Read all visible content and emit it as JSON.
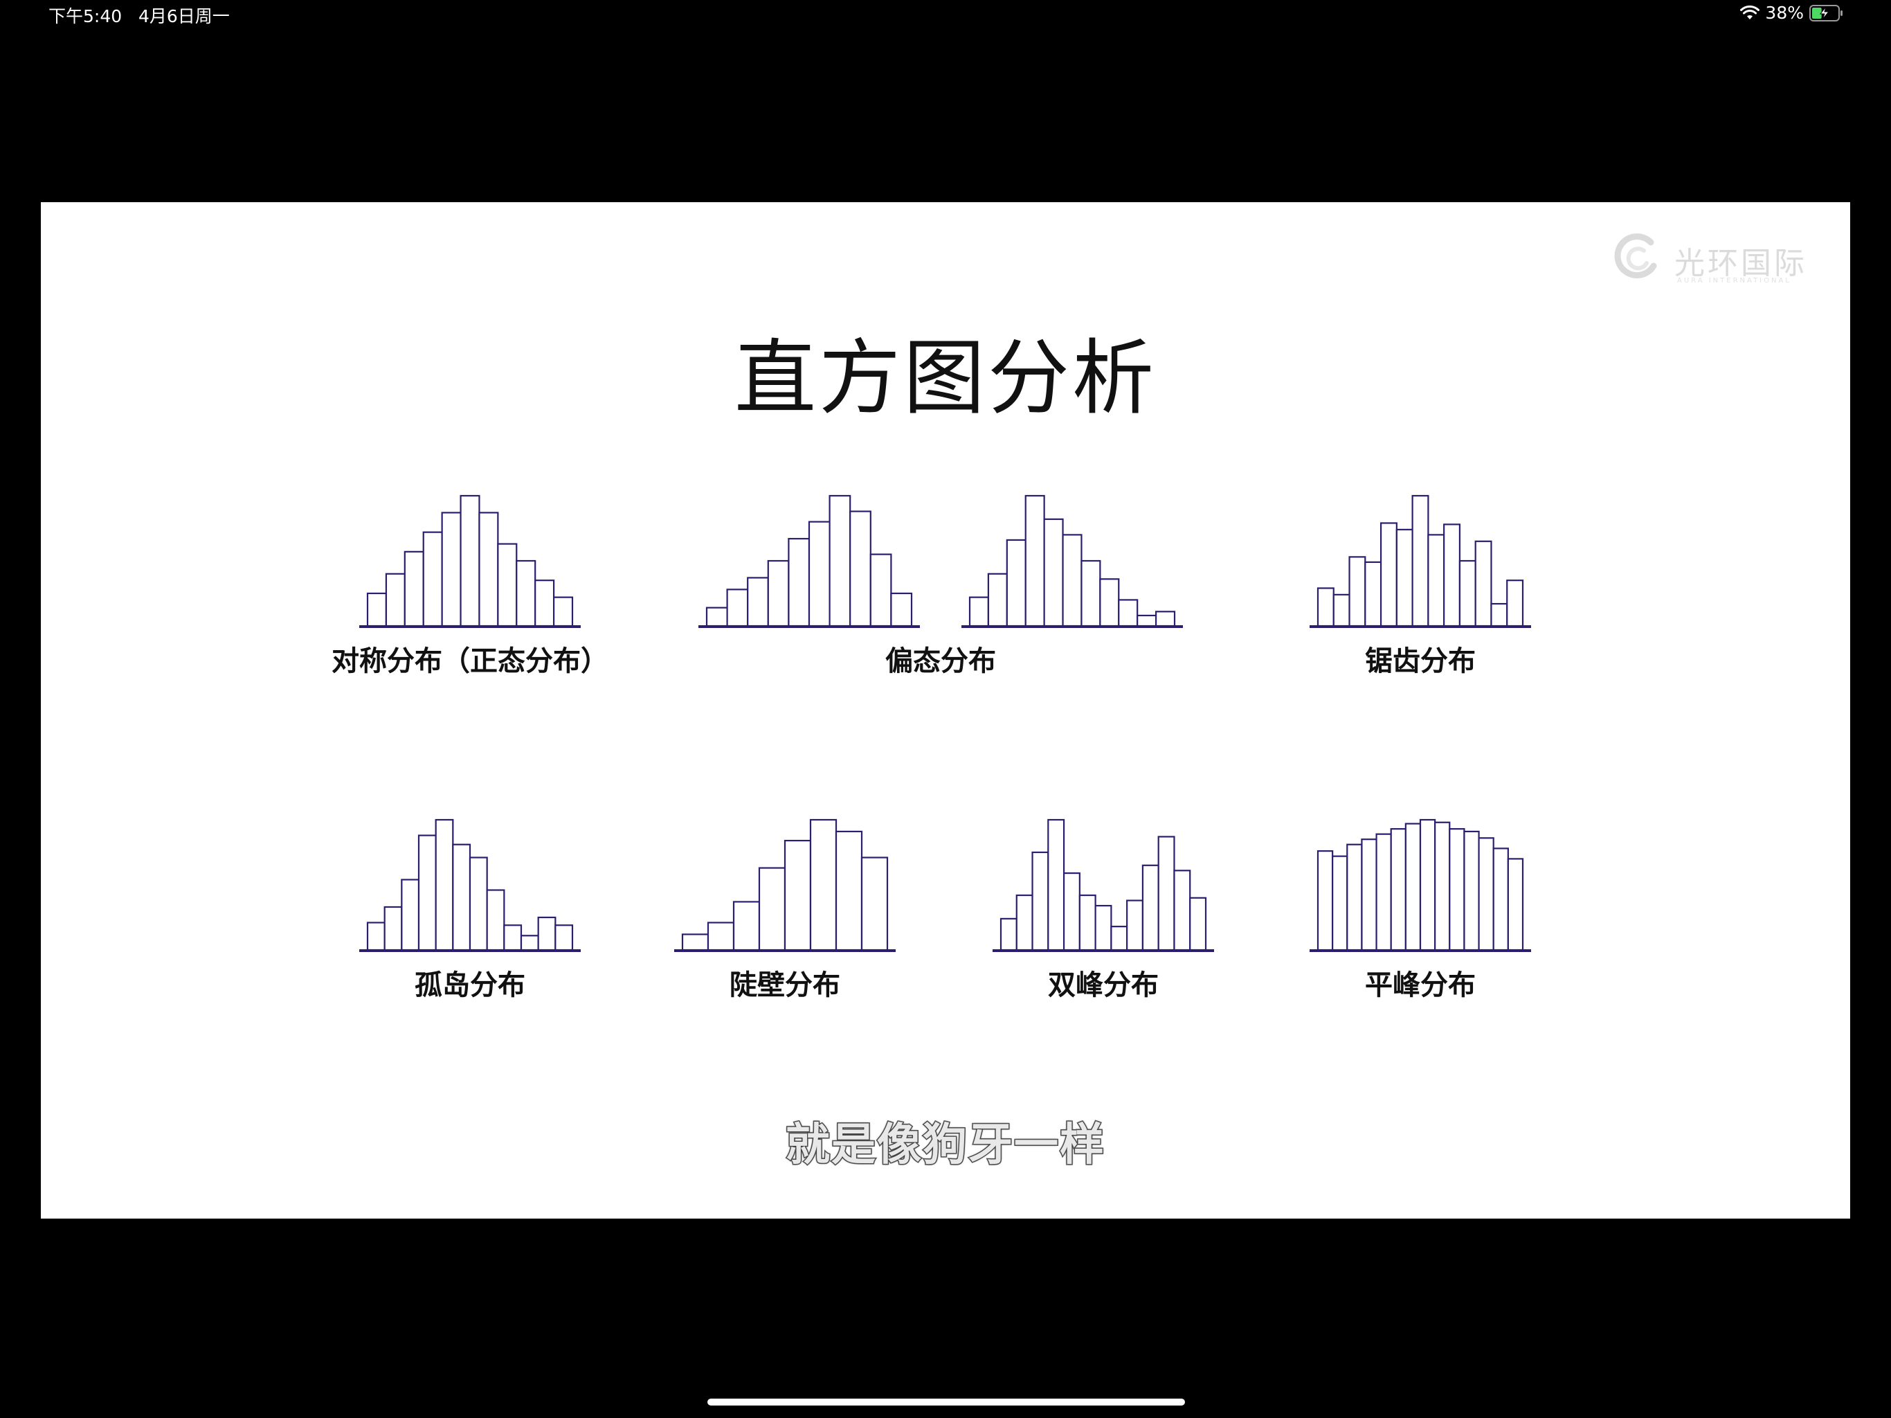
{
  "status_bar": {
    "time": "下午5:40   4月6日周一",
    "battery_percent": "38%",
    "battery_level": 0.38
  },
  "logo": {
    "text": "光环国际",
    "sub": "AURA INTERNATIONAL"
  },
  "slide": {
    "title": "直方图分析",
    "subtitle": "就是像狗牙一样"
  },
  "colors": {
    "bar_stroke": "#2a1f6e",
    "background": "#ffffff"
  },
  "histograms": [
    {
      "id": "symmetric",
      "values": [
        25,
        40,
        57,
        72,
        87,
        100,
        87,
        63,
        50,
        35,
        22
      ]
    },
    {
      "id": "skew-left",
      "values": [
        14,
        28,
        37,
        50,
        67,
        80,
        100,
        88,
        55,
        25
      ]
    },
    {
      "id": "skew-right",
      "values": [
        22,
        40,
        66,
        100,
        82,
        70,
        50,
        36,
        20,
        8,
        11
      ]
    },
    {
      "id": "sawtooth",
      "values": [
        29,
        24,
        53,
        49,
        79,
        74,
        100,
        70,
        78,
        50,
        65,
        17,
        35
      ]
    },
    {
      "id": "island",
      "values": [
        21,
        33,
        54,
        88,
        100,
        81,
        71,
        46,
        19,
        11,
        25,
        19
      ]
    },
    {
      "id": "cliff",
      "values": [
        12,
        21,
        37,
        63,
        84,
        100,
        91,
        71
      ]
    },
    {
      "id": "bimodal",
      "values": [
        24,
        42,
        75,
        100,
        59,
        42,
        34,
        18,
        38,
        65,
        87,
        61,
        40
      ]
    },
    {
      "id": "plateau",
      "values": [
        76,
        72,
        81,
        85,
        89,
        93,
        97,
        100,
        98,
        93,
        91,
        86,
        78,
        70
      ]
    }
  ],
  "labels": {
    "symmetric": "对称分布（正态分布）",
    "skewed": "偏态分布",
    "sawtooth": "锯齿分布",
    "island": "孤岛分布",
    "cliff": "陡壁分布",
    "bimodal": "双峰分布",
    "plateau": "平峰分布"
  }
}
